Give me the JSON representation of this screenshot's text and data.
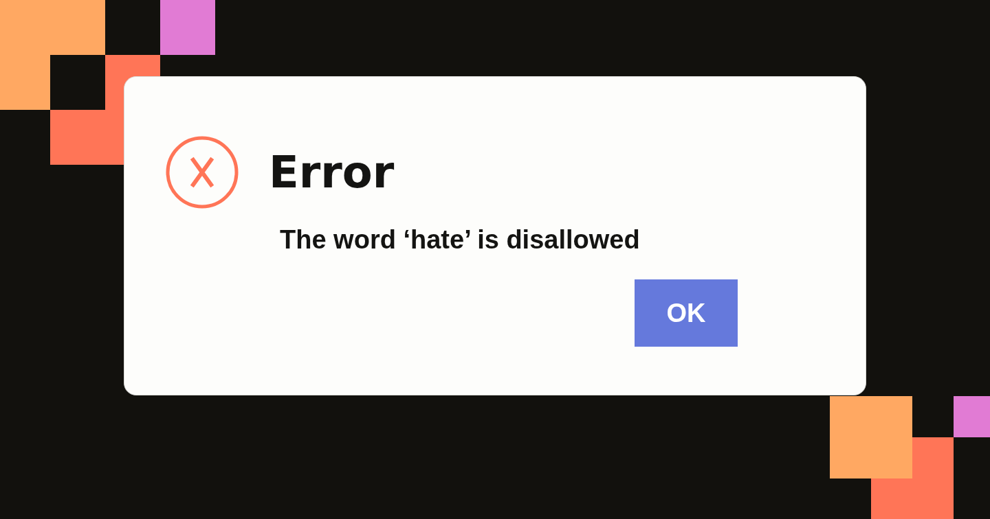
{
  "dialog": {
    "title": "Error",
    "message": "The word ‘hate’ is disallowed",
    "buttons": [
      {
        "label": "OK"
      }
    ]
  }
}
